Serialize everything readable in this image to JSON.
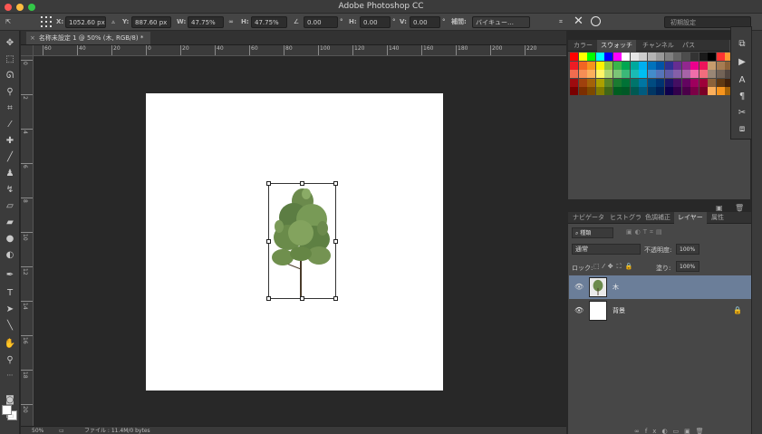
{
  "window": {
    "title": "Adobe Photoshop CC"
  },
  "options": {
    "x_label": "X:",
    "x_value": "1052.60 px",
    "y_label": "Y:",
    "y_value": "887.60 px",
    "w_label": "W:",
    "w_value": "47.75%",
    "h_label": "H:",
    "h_value": "47.75%",
    "angle_value": "0.00",
    "angle_unit": "°",
    "hskew_label": "H:",
    "hskew_value": "0.00",
    "hskew_unit": "°",
    "vskew_label": "V:",
    "vskew_value": "0.00",
    "vskew_unit": "°",
    "interp_label": "補間:",
    "interp_value": "バイキュー…",
    "workspace": "初期設定"
  },
  "document": {
    "tab": "名称未設定 1 @ 50% (木, RGB/8) *",
    "zoom": "50%",
    "status": "ファイル : 11.4M/0 bytes"
  },
  "ruler": {
    "h_labels": [
      "60",
      "40",
      "20",
      "0",
      "20",
      "40",
      "60",
      "80",
      "100",
      "120",
      "140",
      "160",
      "180",
      "200",
      "220"
    ],
    "v_labels": [
      "0",
      "2",
      "4",
      "6",
      "8",
      "10",
      "12",
      "14",
      "16",
      "18",
      "20"
    ]
  },
  "swatch_panel": {
    "tabs": [
      "カラー",
      "スウォッチ",
      "チャンネル",
      "パス"
    ],
    "active_tab": "スウォッチ"
  },
  "layers_panel": {
    "tabs": [
      "ナビゲータ",
      "ヒストグラ",
      "色調補正",
      "レイヤー",
      "属性"
    ],
    "active_tab": "レイヤー",
    "kind_filter": "種類",
    "blend_mode": "通常",
    "opacity_label": "不透明度:",
    "opacity_value": "100%",
    "lock_label": "ロック:",
    "fill_label": "塗り:",
    "fill_value": "100%",
    "layers": [
      {
        "name": "木",
        "selected": true
      },
      {
        "name": "背景",
        "selected": false,
        "locked": true
      }
    ]
  },
  "colors": {
    "accent_selected_layer": "#6b7e99",
    "canvas": "#ffffff",
    "workspace_bg": "#282828"
  }
}
